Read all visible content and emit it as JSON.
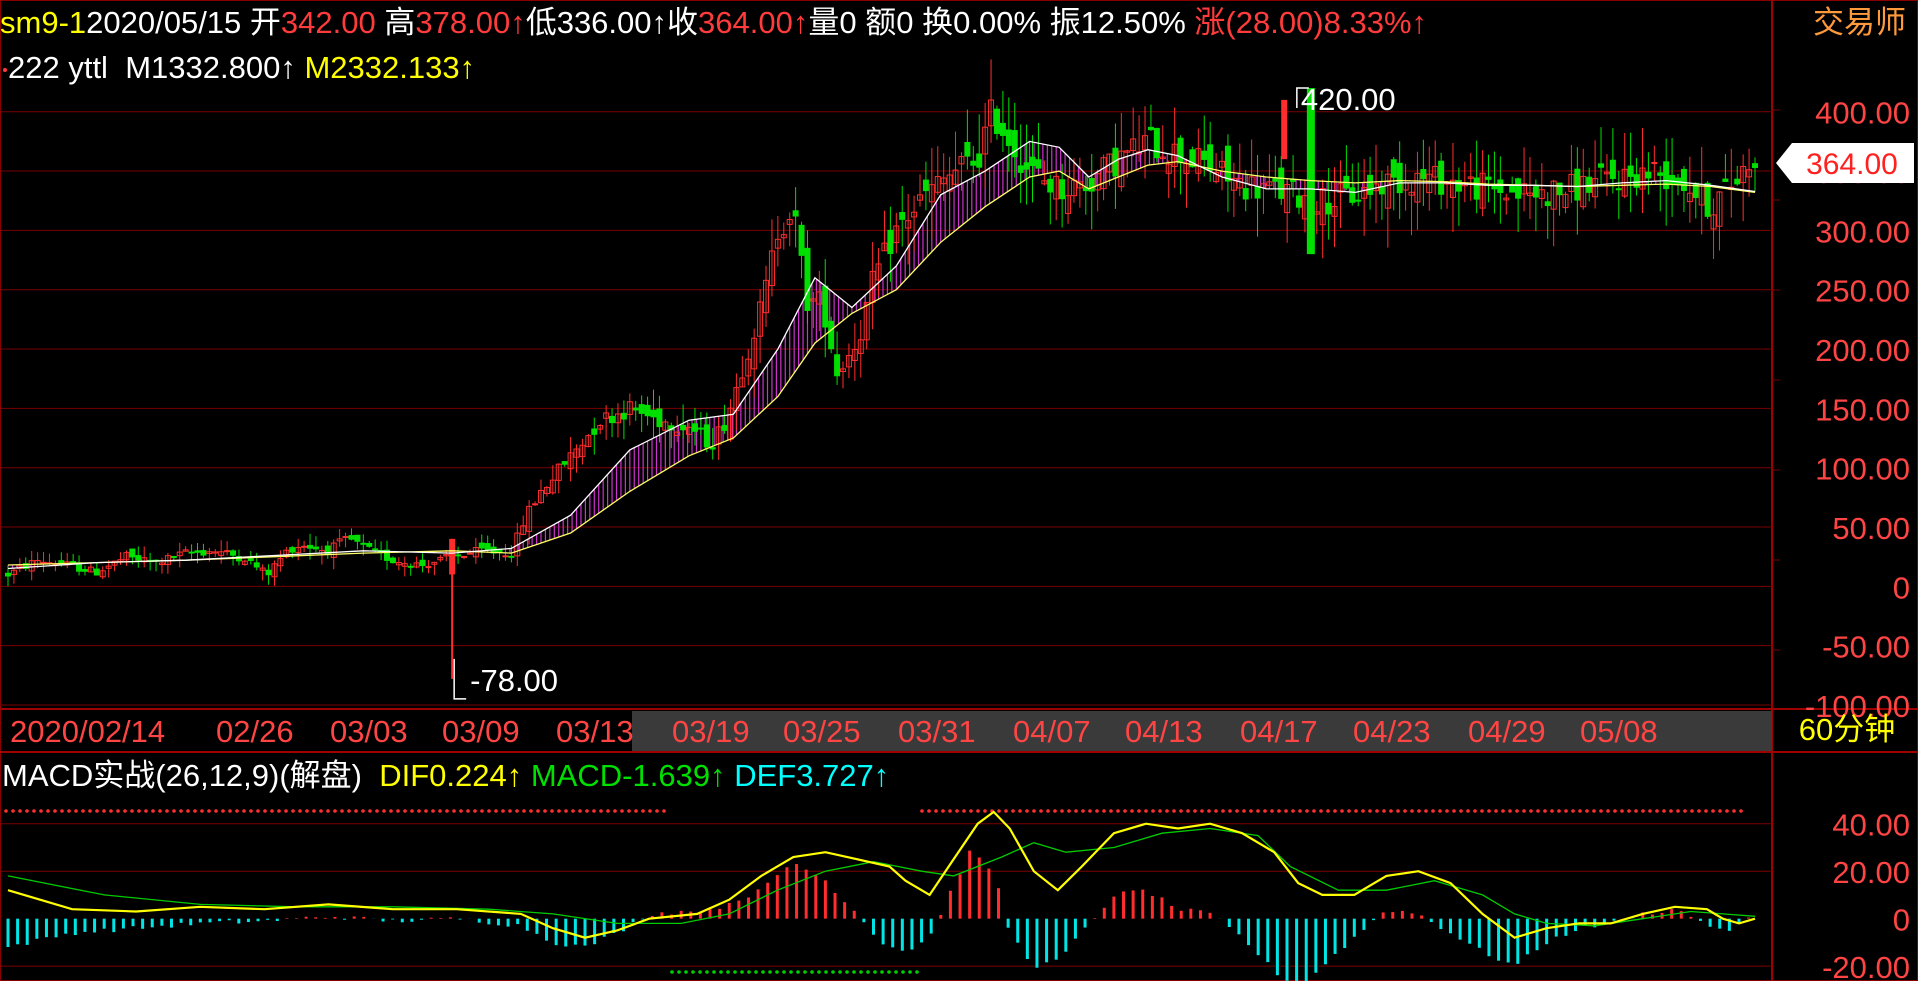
{
  "header": {
    "symbol": "sm9-1",
    "date": "2020/05/15",
    "open_label": "开",
    "open": "342.00",
    "high_label": "高",
    "high": "378.00↑",
    "low_label": "低",
    "low": "336.00↑",
    "close_label": "收",
    "close": "364.00↑",
    "volume_label": "量",
    "volume": "0",
    "amount_label": "额",
    "amount": "0",
    "turnover_label": "换",
    "turnover": "0.00%",
    "amplitude_label": "振",
    "amplitude": "12.50%",
    "change_label": "涨",
    "change": "(28.00)8.33%↑",
    "brand": "交易师"
  },
  "indicator_line": {
    "name": "222 yttl",
    "m1_label": "M1",
    "m1": "332.800↑",
    "m2_label": "M2",
    "m2": "332.133↑"
  },
  "macd_header": {
    "name": "MACD实战(26,12,9)(解盘)",
    "dif_label": "DIF",
    "dif": "0.224↑",
    "macd_label": "MACD",
    "macd": "-1.639↑",
    "def_label": "DEF",
    "def": "3.727↑"
  },
  "current_price_tag": "364.00",
  "period": "60分钟",
  "colors": {
    "up": "#ff2d2d",
    "down": "#00e000",
    "m1": "#ffffff",
    "m2": "#ffff66",
    "fill": "#cc33cc",
    "dif": "#ffff00",
    "dea": "#00cc00",
    "hist_pos": "#ff2d2d",
    "hist_neg": "#00e5e5",
    "axis_text": "#ff4444",
    "grid": "#7a0000"
  },
  "chart_data": [
    {
      "type": "candlestick",
      "title": "",
      "ylim": [
        -100,
        420
      ],
      "y_ticks": [
        "400.00",
        "350.00",
        "300.00",
        "250.00",
        "200.00",
        "150.00",
        "100.00",
        "50.00",
        "0",
        "-50.00",
        "-100.00"
      ],
      "x_tick_labels": [
        "2020/02/14",
        "02/26",
        "03/03",
        "03/09",
        "03/13",
        "03/19",
        "03/25",
        "03/31",
        "04/07",
        "04/13",
        "04/17",
        "04/23",
        "04/29",
        "05/08"
      ],
      "annotations": {
        "high": "420.00",
        "low": "-78.00"
      },
      "close_path": [
        [
          0,
          10
        ],
        [
          20,
          22
        ],
        [
          40,
          18
        ],
        [
          60,
          12
        ],
        [
          80,
          25
        ],
        [
          100,
          20
        ],
        [
          120,
          28
        ],
        [
          140,
          30
        ],
        [
          160,
          24
        ],
        [
          175,
          10
        ],
        [
          190,
          32
        ],
        [
          200,
          35
        ],
        [
          215,
          30
        ],
        [
          230,
          40
        ],
        [
          245,
          30
        ],
        [
          260,
          22
        ],
        [
          280,
          18
        ],
        [
          300,
          25
        ],
        [
          320,
          30
        ],
        [
          340,
          28
        ],
        [
          350,
          60
        ],
        [
          360,
          80
        ],
        [
          380,
          110
        ],
        [
          400,
          140
        ],
        [
          420,
          150
        ],
        [
          440,
          140
        ],
        [
          460,
          135
        ],
        [
          475,
          120
        ],
        [
          485,
          140
        ],
        [
          500,
          200
        ],
        [
          510,
          240
        ],
        [
          520,
          300
        ],
        [
          530,
          320
        ],
        [
          540,
          240
        ],
        [
          550,
          240
        ],
        [
          560,
          180
        ],
        [
          575,
          210
        ],
        [
          585,
          260
        ],
        [
          600,
          300
        ],
        [
          620,
          330
        ],
        [
          640,
          350
        ],
        [
          655,
          360
        ],
        [
          665,
          400
        ],
        [
          675,
          380
        ],
        [
          690,
          350
        ],
        [
          710,
          335
        ],
        [
          730,
          340
        ],
        [
          750,
          360
        ],
        [
          770,
          375
        ],
        [
          790,
          365
        ],
        [
          810,
          355
        ],
        [
          830,
          340
        ],
        [
          850,
          335
        ],
        [
          870,
          330
        ],
        [
          890,
          325
        ],
        [
          910,
          330
        ],
        [
          930,
          340
        ],
        [
          950,
          345
        ],
        [
          970,
          342
        ],
        [
          990,
          338
        ],
        [
          1010,
          333
        ],
        [
          1030,
          330
        ],
        [
          1050,
          333
        ],
        [
          1070,
          340
        ],
        [
          1090,
          345
        ],
        [
          1110,
          350
        ],
        [
          1130,
          343
        ],
        [
          1150,
          320
        ],
        [
          1165,
          340
        ],
        [
          1180,
          364
        ]
      ],
      "m1_path": [
        [
          0,
          15
        ],
        [
          60,
          20
        ],
        [
          120,
          22
        ],
        [
          180,
          26
        ],
        [
          240,
          30
        ],
        [
          300,
          28
        ],
        [
          340,
          32
        ],
        [
          380,
          60
        ],
        [
          420,
          115
        ],
        [
          460,
          140
        ],
        [
          490,
          145
        ],
        [
          520,
          200
        ],
        [
          545,
          260
        ],
        [
          570,
          235
        ],
        [
          600,
          270
        ],
        [
          630,
          330
        ],
        [
          660,
          350
        ],
        [
          690,
          375
        ],
        [
          710,
          370
        ],
        [
          730,
          345
        ],
        [
          750,
          360
        ],
        [
          770,
          368
        ],
        [
          790,
          363
        ],
        [
          820,
          345
        ],
        [
          850,
          335
        ],
        [
          880,
          335
        ],
        [
          910,
          332
        ],
        [
          940,
          340
        ],
        [
          970,
          340
        ],
        [
          1000,
          338
        ],
        [
          1030,
          338
        ],
        [
          1060,
          337
        ],
        [
          1090,
          340
        ],
        [
          1120,
          342
        ],
        [
          1150,
          338
        ],
        [
          1180,
          332.8
        ]
      ],
      "m2_path": [
        [
          0,
          18
        ],
        [
          60,
          20
        ],
        [
          120,
          22
        ],
        [
          180,
          25
        ],
        [
          240,
          28
        ],
        [
          300,
          30
        ],
        [
          340,
          28
        ],
        [
          380,
          45
        ],
        [
          420,
          80
        ],
        [
          460,
          110
        ],
        [
          490,
          125
        ],
        [
          520,
          160
        ],
        [
          545,
          205
        ],
        [
          570,
          230
        ],
        [
          600,
          250
        ],
        [
          630,
          290
        ],
        [
          660,
          320
        ],
        [
          690,
          345
        ],
        [
          710,
          350
        ],
        [
          730,
          335
        ],
        [
          750,
          345
        ],
        [
          770,
          355
        ],
        [
          790,
          358
        ],
        [
          820,
          350
        ],
        [
          850,
          345
        ],
        [
          880,
          342
        ],
        [
          910,
          340
        ],
        [
          940,
          342
        ],
        [
          970,
          341
        ],
        [
          1000,
          339
        ],
        [
          1030,
          338
        ],
        [
          1060,
          337
        ],
        [
          1090,
          338
        ],
        [
          1120,
          339
        ],
        [
          1150,
          337
        ],
        [
          1180,
          332.1
        ]
      ]
    },
    {
      "type": "macd",
      "title": "MACD实战(26,12,9)(解盘)",
      "ylim": [
        -25,
        50
      ],
      "y_ticks": [
        "40.00",
        "20.00",
        "0",
        "-20.00"
      ],
      "dif_path": [
        [
          0,
          12
        ],
        [
          40,
          4
        ],
        [
          80,
          3
        ],
        [
          120,
          5
        ],
        [
          160,
          4
        ],
        [
          200,
          6
        ],
        [
          240,
          4
        ],
        [
          280,
          4
        ],
        [
          320,
          2
        ],
        [
          340,
          -4
        ],
        [
          360,
          -8
        ],
        [
          380,
          -5
        ],
        [
          400,
          0
        ],
        [
          430,
          2
        ],
        [
          450,
          8
        ],
        [
          470,
          18
        ],
        [
          490,
          26
        ],
        [
          510,
          28
        ],
        [
          530,
          25
        ],
        [
          550,
          22
        ],
        [
          560,
          16
        ],
        [
          575,
          10
        ],
        [
          590,
          25
        ],
        [
          605,
          40
        ],
        [
          615,
          45
        ],
        [
          625,
          38
        ],
        [
          640,
          20
        ],
        [
          655,
          12
        ],
        [
          670,
          22
        ],
        [
          690,
          36
        ],
        [
          710,
          40
        ],
        [
          730,
          38
        ],
        [
          750,
          40
        ],
        [
          770,
          36
        ],
        [
          790,
          28
        ],
        [
          805,
          15
        ],
        [
          820,
          10
        ],
        [
          840,
          10
        ],
        [
          860,
          18
        ],
        [
          880,
          20
        ],
        [
          900,
          15
        ],
        [
          920,
          2
        ],
        [
          940,
          -8
        ],
        [
          960,
          -4
        ],
        [
          980,
          -2
        ],
        [
          1000,
          -2
        ],
        [
          1020,
          2
        ],
        [
          1040,
          5
        ],
        [
          1060,
          4
        ],
        [
          1070,
          0
        ],
        [
          1080,
          -2
        ],
        [
          1090,
          0
        ]
      ],
      "dea_path": [
        [
          0,
          18
        ],
        [
          60,
          10
        ],
        [
          120,
          6
        ],
        [
          180,
          5
        ],
        [
          240,
          5
        ],
        [
          300,
          4
        ],
        [
          340,
          2
        ],
        [
          380,
          -2
        ],
        [
          420,
          -2
        ],
        [
          450,
          2
        ],
        [
          480,
          12
        ],
        [
          510,
          20
        ],
        [
          540,
          24
        ],
        [
          570,
          20
        ],
        [
          590,
          18
        ],
        [
          620,
          26
        ],
        [
          640,
          32
        ],
        [
          660,
          28
        ],
        [
          690,
          30
        ],
        [
          720,
          36
        ],
        [
          750,
          38
        ],
        [
          780,
          35
        ],
        [
          800,
          22
        ],
        [
          830,
          12
        ],
        [
          860,
          12
        ],
        [
          890,
          16
        ],
        [
          920,
          10
        ],
        [
          940,
          2
        ],
        [
          960,
          -2
        ],
        [
          990,
          -3
        ],
        [
          1020,
          0
        ],
        [
          1050,
          3
        ],
        [
          1070,
          2
        ],
        [
          1090,
          1
        ]
      ],
      "hist_env": [
        [
          0,
          -12
        ],
        [
          40,
          -6
        ],
        [
          80,
          -4
        ],
        [
          120,
          -2
        ],
        [
          160,
          -1
        ],
        [
          200,
          1
        ],
        [
          240,
          -1
        ],
        [
          280,
          0
        ],
        [
          320,
          -3
        ],
        [
          340,
          -10
        ],
        [
          360,
          -12
        ],
        [
          380,
          -6
        ],
        [
          400,
          2
        ],
        [
          440,
          4
        ],
        [
          470,
          12
        ],
        [
          490,
          24
        ],
        [
          510,
          16
        ],
        [
          530,
          2
        ],
        [
          545,
          -10
        ],
        [
          560,
          -14
        ],
        [
          575,
          -8
        ],
        [
          590,
          14
        ],
        [
          600,
          28
        ],
        [
          615,
          20
        ],
        [
          625,
          -6
        ],
        [
          640,
          -20
        ],
        [
          655,
          -18
        ],
        [
          670,
          -6
        ],
        [
          690,
          10
        ],
        [
          710,
          12
        ],
        [
          730,
          4
        ],
        [
          750,
          2
        ],
        [
          770,
          -8
        ],
        [
          790,
          -22
        ],
        [
          805,
          -30
        ],
        [
          820,
          -20
        ],
        [
          840,
          -8
        ],
        [
          860,
          4
        ],
        [
          880,
          2
        ],
        [
          900,
          -6
        ],
        [
          920,
          -14
        ],
        [
          940,
          -20
        ],
        [
          960,
          -10
        ],
        [
          980,
          -4
        ],
        [
          1000,
          -2
        ],
        [
          1020,
          2
        ],
        [
          1040,
          4
        ],
        [
          1060,
          -2
        ],
        [
          1070,
          -6
        ],
        [
          1090,
          1.6
        ]
      ]
    }
  ]
}
